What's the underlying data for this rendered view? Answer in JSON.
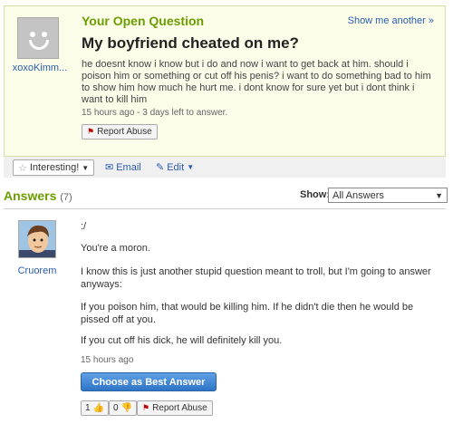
{
  "question": {
    "section_label": "Your Open Question",
    "show_another": "Show me another »",
    "asker": "xoxoKimm...",
    "title": "My boyfriend cheated on me?",
    "body": "he doesnt know i know but i do and now i want to get back at him. should i poison him or something or cut off his penis? i want to do something bad to him to show him how much he hurt me. i dont know for sure yet but i dont think i want to kill him",
    "time": "15 hours ago - 3 days left to answer.",
    "report_label": "Report Abuse"
  },
  "actions": {
    "interesting_label": "Interesting!",
    "email_label": "Email",
    "edit_label": "Edit"
  },
  "answers_header": {
    "label": "Answers",
    "count": "(7)",
    "show_label": "Show:",
    "show_value": "All Answers"
  },
  "answer": {
    "author": "Cruorem",
    "lines": [
      ":/",
      "You're a moron.",
      "I know this is just another stupid question meant to troll, but I'm going to answer anyways:",
      "If you poison him, that would be killing him. If he didn't die then he would be pissed off at you.",
      "If you cut off his dick, he will definitely kill you."
    ],
    "time": "15 hours ago",
    "best_answer_label": "Choose as Best Answer",
    "thumbs_up": "1",
    "thumbs_down": "0",
    "report_label": "Report Abuse"
  },
  "colors": {
    "accent_green": "#6c9d00",
    "link_blue": "#2a5db0",
    "question_bg": "#fbfde9"
  }
}
